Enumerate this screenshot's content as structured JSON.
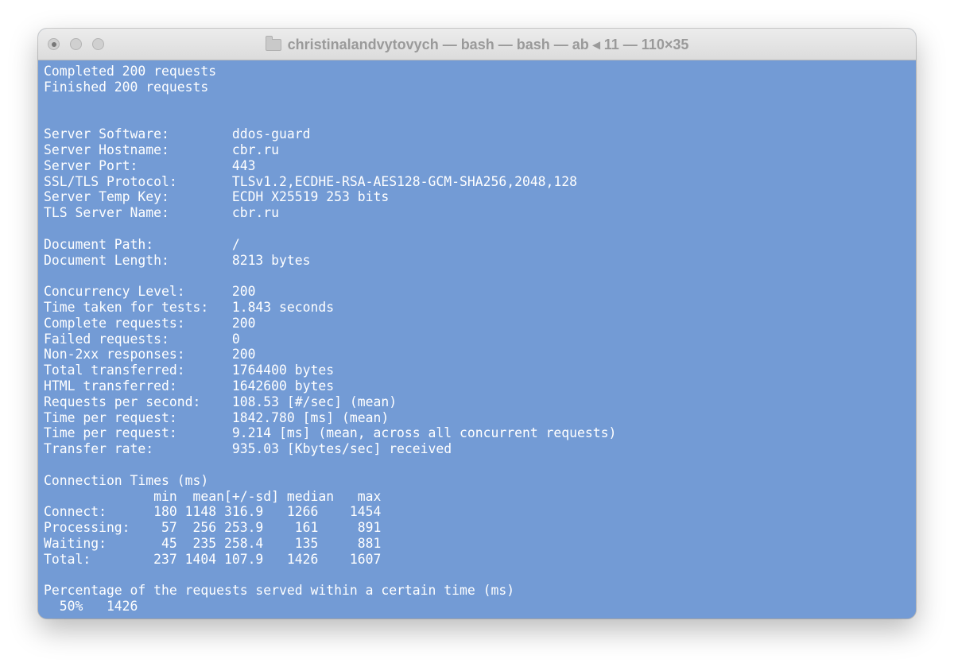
{
  "window": {
    "title": "christinalandvytovych — bash  — bash — ab ◂ 11 — 110×35"
  },
  "colors": {
    "terminal_background": "#739bd5",
    "terminal_text": "#ffffff",
    "titlebar": "#e4e4e4"
  },
  "icons": {
    "title_icon": "folder-icon",
    "close": "close-button-icon",
    "minimize": "minimize-button-icon",
    "zoom": "zoom-button-icon"
  },
  "terminal": {
    "lines": [
      "Completed 200 requests",
      "Finished 200 requests",
      "",
      "",
      "Server Software:        ddos-guard",
      "Server Hostname:        cbr.ru",
      "Server Port:            443",
      "SSL/TLS Protocol:       TLSv1.2,ECDHE-RSA-AES128-GCM-SHA256,2048,128",
      "Server Temp Key:        ECDH X25519 253 bits",
      "TLS Server Name:        cbr.ru",
      "",
      "Document Path:          /",
      "Document Length:        8213 bytes",
      "",
      "Concurrency Level:      200",
      "Time taken for tests:   1.843 seconds",
      "Complete requests:      200",
      "Failed requests:        0",
      "Non-2xx responses:      200",
      "Total transferred:      1764400 bytes",
      "HTML transferred:       1642600 bytes",
      "Requests per second:    108.53 [#/sec] (mean)",
      "Time per request:       1842.780 [ms] (mean)",
      "Time per request:       9.214 [ms] (mean, across all concurrent requests)",
      "Transfer rate:          935.03 [Kbytes/sec] received",
      "",
      "Connection Times (ms)",
      "              min  mean[+/-sd] median   max",
      "Connect:      180 1148 316.9   1266    1454",
      "Processing:    57  256 253.9    161     891",
      "Waiting:       45  235 258.4    135     881",
      "Total:        237 1404 107.9   1426    1607",
      "",
      "Percentage of the requests served within a certain time (ms)",
      "  50%   1426"
    ]
  }
}
